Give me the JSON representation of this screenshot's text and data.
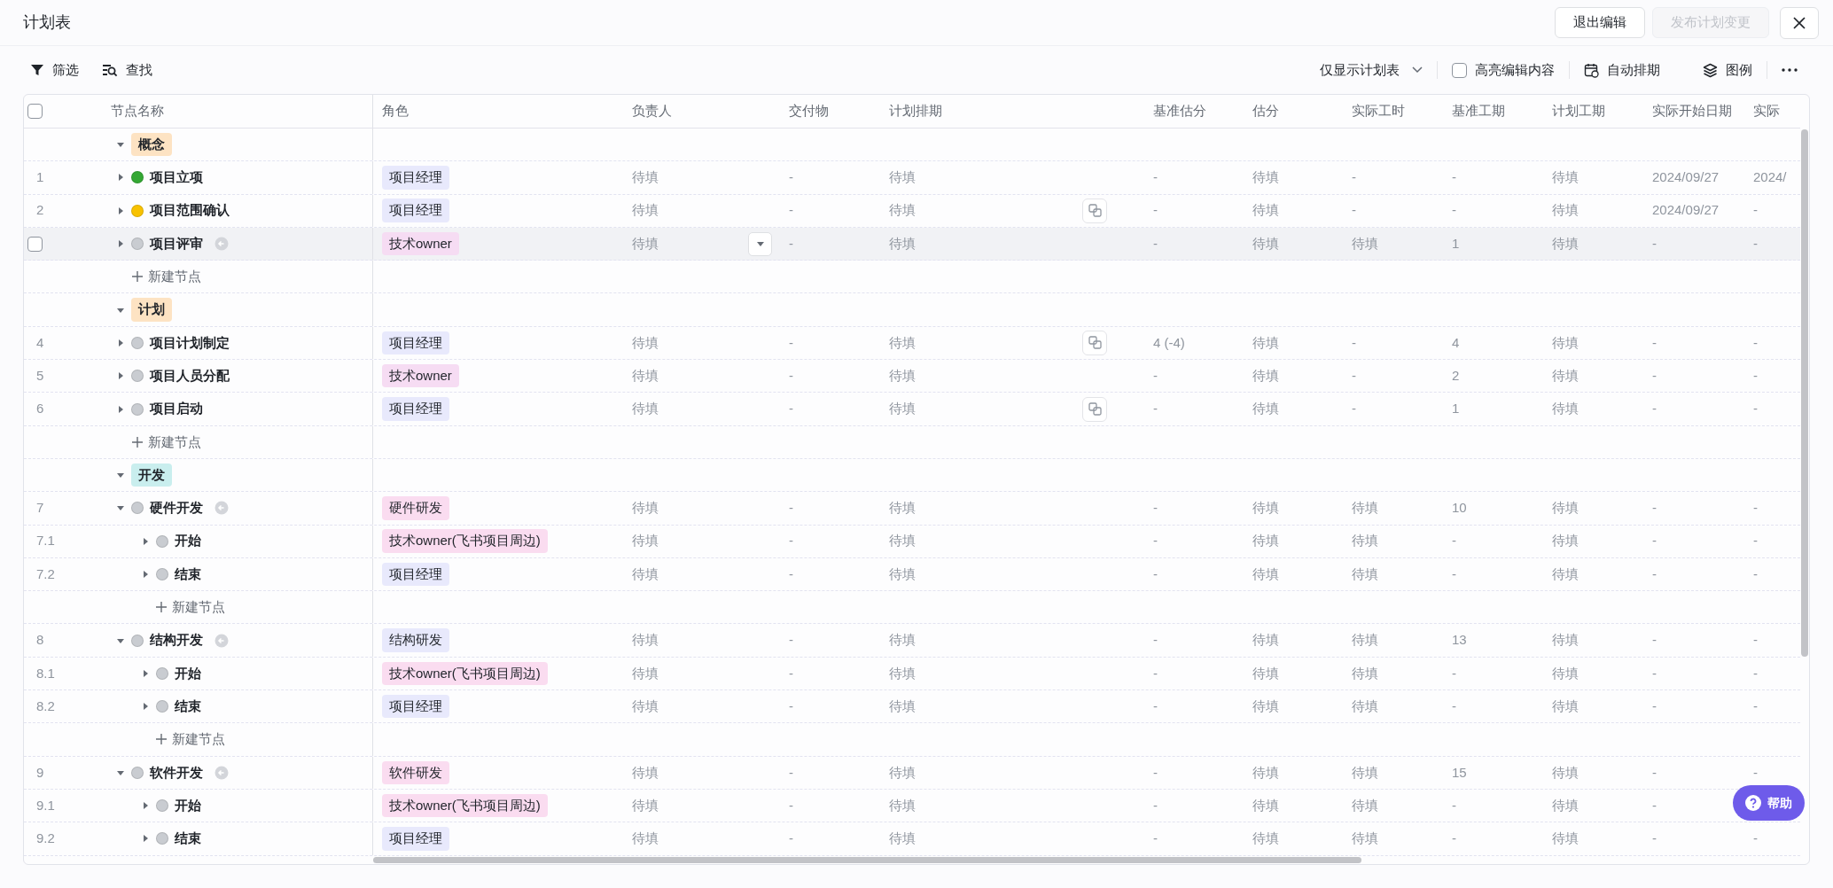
{
  "title": "计划表",
  "header_buttons": [
    {
      "label": "退出编辑",
      "disabled": false
    },
    {
      "label": "发布计划变更",
      "disabled": true
    }
  ],
  "toolbar": {
    "left": [
      {
        "kind": "filter",
        "label": "筛选"
      },
      {
        "kind": "search",
        "label": "查找"
      }
    ],
    "view_select": "仅显示计划表",
    "highlight": {
      "label": "高亮编辑内容",
      "checked": false
    },
    "right": [
      {
        "kind": "schedule",
        "label": "自动排期"
      },
      {
        "kind": "legend",
        "label": "图例"
      }
    ]
  },
  "table": {
    "select_all_checked": false,
    "columns": [
      "节点名称",
      "角色",
      "负责人",
      "交付物",
      "计划排期",
      "基准估分",
      "估分",
      "实际工时",
      "基准工期",
      "计划工期",
      "实际开始日期",
      "实际"
    ],
    "groups": [
      {
        "label": "概念",
        "color": "#fde3c3",
        "expanded": true,
        "add_label": "新建节点",
        "children": [
          {
            "number": "1",
            "name": "项目立项",
            "color": "#34a834",
            "expanded": false,
            "link_icon": false,
            "hovered": false,
            "role": {
              "label": "项目经理",
              "color": "#e8e9fc"
            },
            "schedule_icon": false,
            "cells": [
              "待填",
              "-",
              "待填",
              "-",
              "待填",
              "-",
              "-",
              "待填",
              "2024/09/27",
              "2024/"
            ]
          },
          {
            "number": "2",
            "name": "项目范围确认",
            "color": "#f8c200",
            "expanded": false,
            "link_icon": false,
            "hovered": false,
            "role": {
              "label": "项目经理",
              "color": "#e8e9fc"
            },
            "schedule_icon": true,
            "cells": [
              "待填",
              "-",
              "待填",
              "-",
              "待填",
              "-",
              "-",
              "待填",
              "2024/09/27",
              "-"
            ]
          },
          {
            "name": "项目评审",
            "color": "#c9ccd1",
            "expanded": false,
            "link_icon": true,
            "hovered": true,
            "checked": false,
            "role": {
              "label": "技术owner",
              "color": "#f6dcf3"
            },
            "schedule_icon": false,
            "cells": [
              "待填",
              "-",
              "待填",
              "-",
              "待填",
              "待填",
              "1",
              "待填",
              "-",
              "-"
            ]
          }
        ]
      },
      {
        "label": "计划",
        "color": "#fde3c3",
        "expanded": true,
        "add_label": "新建节点",
        "children": [
          {
            "number": "4",
            "name": "项目计划制定",
            "color": "#c9ccd1",
            "expanded": false,
            "link_icon": false,
            "hovered": false,
            "role": {
              "label": "项目经理",
              "color": "#e8e9fc"
            },
            "schedule_icon": true,
            "cells": [
              "待填",
              "-",
              "待填",
              "4 (-4)",
              "待填",
              "-",
              "4",
              "待填",
              "-",
              "-"
            ]
          },
          {
            "number": "5",
            "name": "项目人员分配",
            "color": "#c9ccd1",
            "expanded": false,
            "link_icon": false,
            "hovered": false,
            "role": {
              "label": "技术owner",
              "color": "#f6dcf3"
            },
            "schedule_icon": false,
            "cells": [
              "待填",
              "-",
              "待填",
              "-",
              "待填",
              "-",
              "2",
              "待填",
              "-",
              "-"
            ]
          },
          {
            "number": "6",
            "name": "项目启动",
            "color": "#c9ccd1",
            "expanded": false,
            "link_icon": false,
            "hovered": false,
            "role": {
              "label": "项目经理",
              "color": "#e8e9fc"
            },
            "schedule_icon": true,
            "cells": [
              "待填",
              "-",
              "待填",
              "-",
              "待填",
              "-",
              "1",
              "待填",
              "-",
              "-"
            ]
          }
        ]
      },
      {
        "label": "开发",
        "color": "#c9eeee",
        "expanded": true,
        "children": [
          {
            "number": "7",
            "name": "硬件开发",
            "color": "#c9ccd1",
            "expanded": true,
            "link_icon": true,
            "hovered": false,
            "role": {
              "label": "硬件研发",
              "color": "#fadcf0"
            },
            "schedule_icon": false,
            "cells": [
              "待填",
              "-",
              "待填",
              "-",
              "待填",
              "待填",
              "10",
              "待填",
              "-",
              "-"
            ],
            "add_label": "新建节点",
            "children": [
              {
                "number": "7.1",
                "name": "开始",
                "color": "#c9ccd1",
                "expanded": false,
                "link_icon": false,
                "hovered": false,
                "role": {
                  "label": "技术owner(飞书项目周边)",
                  "color": "#fadcf0"
                },
                "schedule_icon": false,
                "cells": [
                  "待填",
                  "-",
                  "待填",
                  "-",
                  "待填",
                  "待填",
                  "-",
                  "待填",
                  "-",
                  "-"
                ]
              },
              {
                "number": "7.2",
                "name": "结束",
                "color": "#c9ccd1",
                "expanded": false,
                "link_icon": false,
                "hovered": false,
                "role": {
                  "label": "项目经理",
                  "color": "#e8e9fc"
                },
                "schedule_icon": false,
                "cells": [
                  "待填",
                  "-",
                  "待填",
                  "-",
                  "待填",
                  "待填",
                  "-",
                  "待填",
                  "-",
                  "-"
                ]
              }
            ]
          },
          {
            "number": "8",
            "name": "结构开发",
            "color": "#c9ccd1",
            "expanded": true,
            "link_icon": true,
            "hovered": false,
            "role": {
              "label": "结构研发",
              "color": "#e8e9fc"
            },
            "schedule_icon": false,
            "cells": [
              "待填",
              "-",
              "待填",
              "-",
              "待填",
              "待填",
              "13",
              "待填",
              "-",
              "-"
            ],
            "add_label": "新建节点",
            "children": [
              {
                "number": "8.1",
                "name": "开始",
                "color": "#c9ccd1",
                "expanded": false,
                "link_icon": false,
                "hovered": false,
                "role": {
                  "label": "技术owner(飞书项目周边)",
                  "color": "#fadcf0"
                },
                "schedule_icon": false,
                "cells": [
                  "待填",
                  "-",
                  "待填",
                  "-",
                  "待填",
                  "待填",
                  "-",
                  "待填",
                  "-",
                  "-"
                ]
              },
              {
                "number": "8.2",
                "name": "结束",
                "color": "#c9ccd1",
                "expanded": false,
                "link_icon": false,
                "hovered": false,
                "role": {
                  "label": "项目经理",
                  "color": "#e8e9fc"
                },
                "schedule_icon": false,
                "cells": [
                  "待填",
                  "-",
                  "待填",
                  "-",
                  "待填",
                  "待填",
                  "-",
                  "待填",
                  "-",
                  "-"
                ]
              }
            ]
          },
          {
            "number": "9",
            "name": "软件开发",
            "color": "#c9ccd1",
            "expanded": true,
            "link_icon": true,
            "hovered": false,
            "role": {
              "label": "软件研发",
              "color": "#fadcf0"
            },
            "schedule_icon": false,
            "cells": [
              "待填",
              "-",
              "待填",
              "-",
              "待填",
              "待填",
              "15",
              "待填",
              "-",
              "-"
            ],
            "children": [
              {
                "number": "9.1",
                "name": "开始",
                "color": "#c9ccd1",
                "expanded": false,
                "link_icon": false,
                "hovered": false,
                "role": {
                  "label": "技术owner(飞书项目周边)",
                  "color": "#fadcf0"
                },
                "schedule_icon": false,
                "cells": [
                  "待填",
                  "-",
                  "待填",
                  "-",
                  "待填",
                  "待填",
                  "-",
                  "待填",
                  "-",
                  null
                ]
              },
              {
                "number": "9.2",
                "name": "结束",
                "color": "#c9ccd1",
                "expanded": false,
                "link_icon": false,
                "hovered": false,
                "role": {
                  "label": "项目经理",
                  "color": "#e8e9fc"
                },
                "schedule_icon": false,
                "cells": [
                  "待填",
                  "-",
                  "待填",
                  "-",
                  "待填",
                  "待填",
                  "-",
                  "待填",
                  "-",
                  "-"
                ]
              }
            ]
          }
        ]
      }
    ]
  },
  "help": {
    "label": "帮助"
  }
}
